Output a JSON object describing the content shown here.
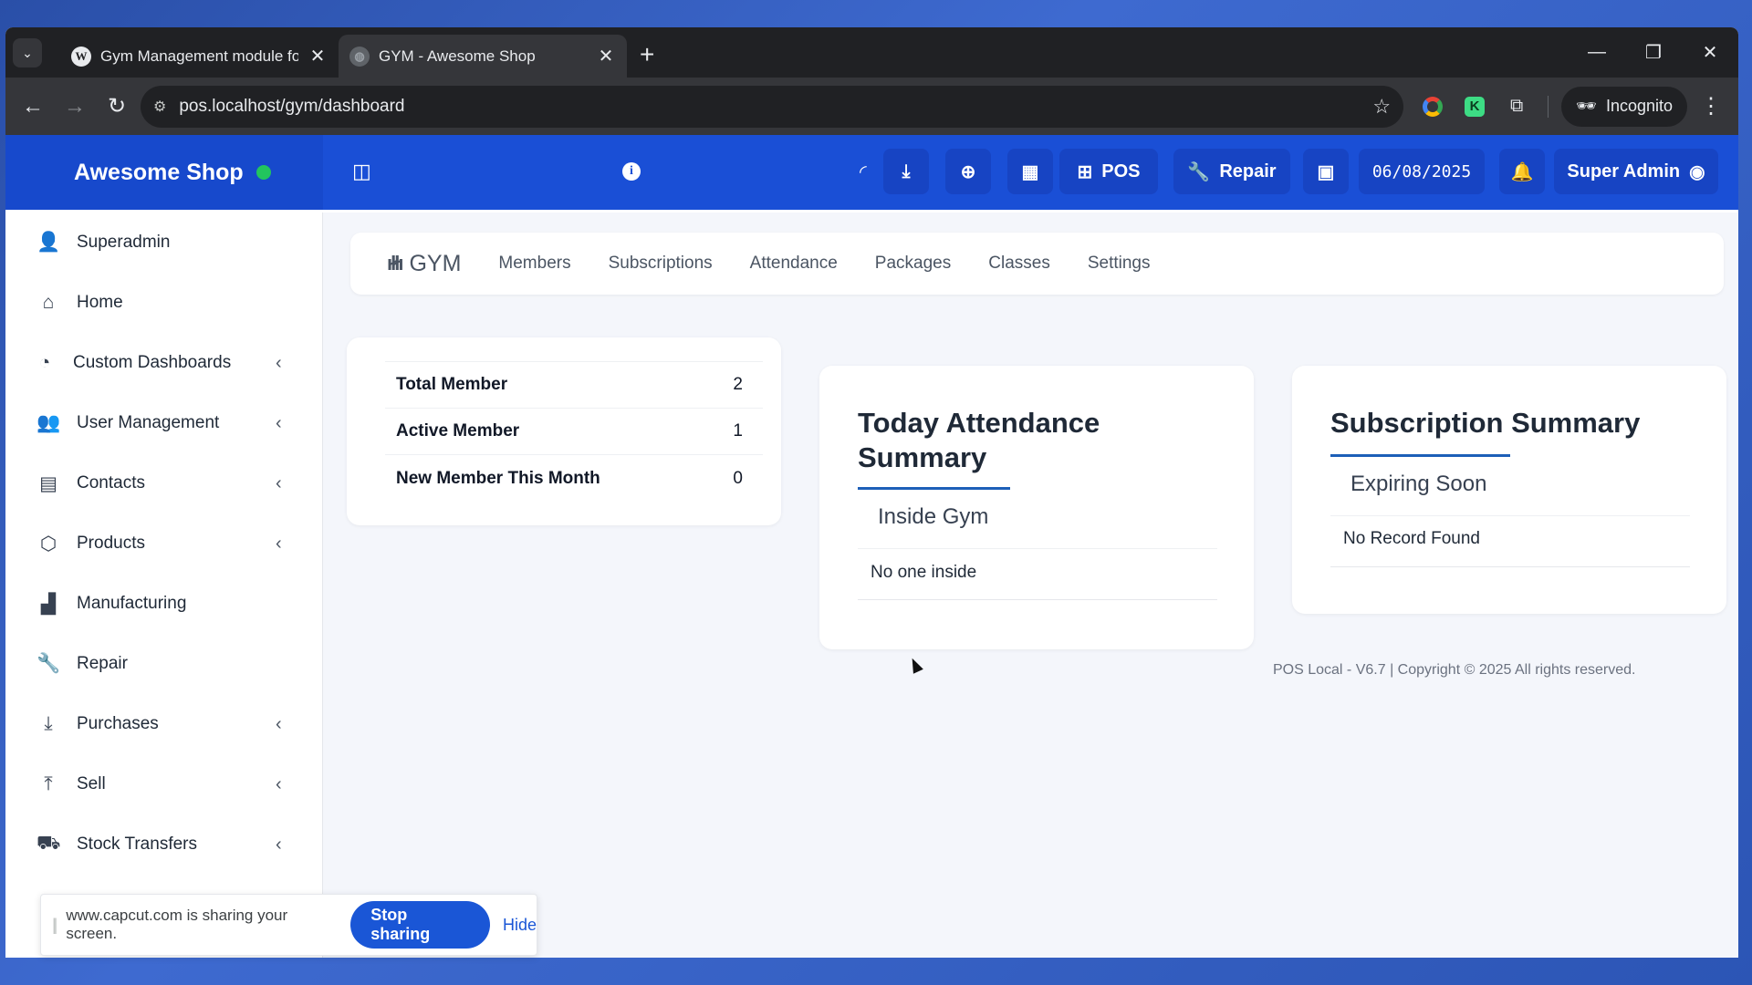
{
  "browser": {
    "tabs": [
      {
        "title": "Gym Management module for U",
        "favicon": "wordpress-icon"
      },
      {
        "title": "GYM - Awesome Shop",
        "favicon": "globe-icon"
      }
    ],
    "url": "pos.localhost/gym/dashboard",
    "incognito_label": "Incognito"
  },
  "header": {
    "brand": "Awesome Shop",
    "pos_label": "POS",
    "repair_label": "Repair",
    "date": "06/08/2025",
    "user": "Super Admin"
  },
  "sidebar": {
    "items": [
      {
        "label": "Superadmin",
        "icon": "user-cog-icon"
      },
      {
        "label": "Home",
        "icon": "home-icon"
      },
      {
        "label": "Custom Dashboards",
        "icon": "dashboard-icon"
      },
      {
        "label": "User Management",
        "icon": "users-icon"
      },
      {
        "label": "Contacts",
        "icon": "address-book-icon"
      },
      {
        "label": "Products",
        "icon": "box-icon"
      },
      {
        "label": "Manufacturing",
        "icon": "factory-icon"
      },
      {
        "label": "Repair",
        "icon": "wrench-icon"
      },
      {
        "label": "Purchases",
        "icon": "download-icon"
      },
      {
        "label": "Sell",
        "icon": "upload-icon"
      },
      {
        "label": "Stock Transfers",
        "icon": "truck-icon"
      }
    ]
  },
  "gym_nav": {
    "brand": "GYM",
    "links": [
      "Members",
      "Subscriptions",
      "Attendance",
      "Packages",
      "Classes",
      "Settings"
    ]
  },
  "stats": {
    "rows": [
      {
        "label": "Total Member",
        "value": "2"
      },
      {
        "label": "Active Member",
        "value": "1"
      },
      {
        "label": "New Member This Month",
        "value": "0"
      }
    ]
  },
  "attendance": {
    "title": "Today Attendance Summary",
    "tab": "Inside Gym",
    "empty": "No one inside"
  },
  "subscription": {
    "title": "Subscription Summary",
    "tab": "Expiring Soon",
    "empty": "No Record Found"
  },
  "footer": "POS Local - V6.7 | Copyright © 2025 All rights reserved.",
  "share_bar": {
    "message": "www.capcut.com is sharing your screen.",
    "stop_label": "Stop sharing",
    "hide_label": "Hide"
  },
  "colors": {
    "header": "#1a4fd6",
    "accent": "#1d5fb8",
    "status_dot": "#22c55e"
  }
}
